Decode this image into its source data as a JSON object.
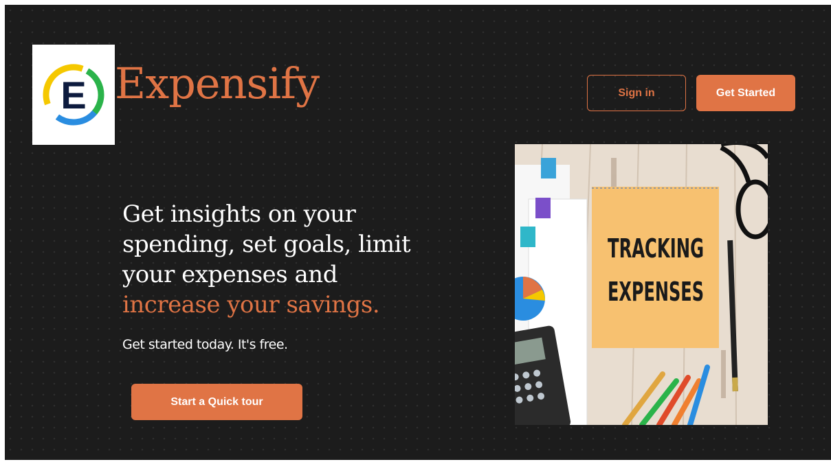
{
  "header": {
    "brand_name": "Expensify",
    "logo_letter": "E",
    "signin_label": "Sign in",
    "get_started_label": "Get Started"
  },
  "hero": {
    "headline_line1": "Get insights on your",
    "headline_line2": "spending, set goals, limit",
    "headline_line3": "your expenses and",
    "headline_accent": "increase your savings.",
    "subtext": "Get started today. It's free.",
    "tour_button_label": "Start a Quick tour"
  },
  "image": {
    "notepad_line1": "TRACKING",
    "notepad_line2": "EXPENSES"
  },
  "colors": {
    "accent": "#e07445",
    "background": "#1c1c1c",
    "text": "#ffffff"
  }
}
